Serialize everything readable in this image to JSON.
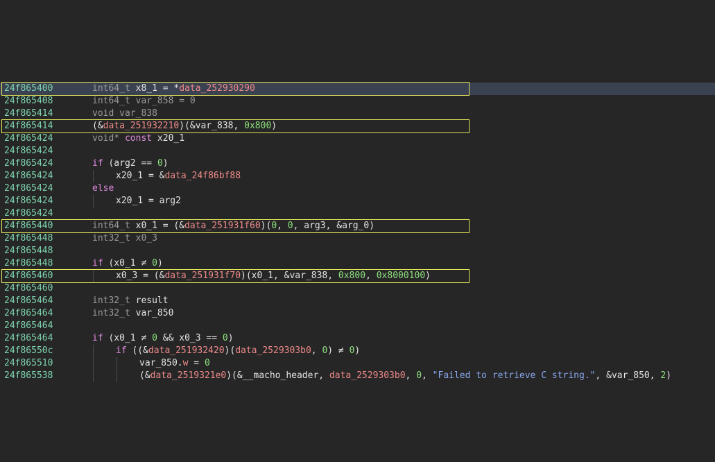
{
  "highlight_color": "#e4e65a",
  "address_color": "#7fd6b0",
  "lines": [
    {
      "addr": "24f865400",
      "current": true,
      "boxed": true,
      "indent": 0,
      "tokens": [
        {
          "t": "int64_t ",
          "c": "type"
        },
        {
          "t": "x8_1 = *",
          "c": "plain"
        },
        {
          "t": "data_252930290",
          "c": "data"
        }
      ]
    },
    {
      "addr": "24f865408",
      "indent": 0,
      "tokens": [
        {
          "t": "int64_t var_858 = 0",
          "c": "type"
        }
      ]
    },
    {
      "addr": "24f865414",
      "indent": 0,
      "tokens": [
        {
          "t": "void var_838",
          "c": "type"
        }
      ]
    },
    {
      "addr": "24f865414",
      "boxed": true,
      "indent": 0,
      "tokens": [
        {
          "t": "(&",
          "c": "plain"
        },
        {
          "t": "data_251932210",
          "c": "data"
        },
        {
          "t": ")(&var_838, ",
          "c": "plain"
        },
        {
          "t": "0x800",
          "c": "num"
        },
        {
          "t": ")",
          "c": "plain"
        }
      ]
    },
    {
      "addr": "24f865424",
      "indent": 0,
      "tokens": [
        {
          "t": "void* ",
          "c": "type"
        },
        {
          "t": "const",
          "c": "kw"
        },
        {
          "t": " x20_1",
          "c": "plain"
        }
      ]
    },
    {
      "addr": "24f865424",
      "indent": 0,
      "tokens": []
    },
    {
      "addr": "24f865424",
      "indent": 0,
      "tokens": [
        {
          "t": "if",
          "c": "kw"
        },
        {
          "t": " (arg2 ",
          "c": "plain"
        },
        {
          "t": "==",
          "c": "plain"
        },
        {
          "t": " ",
          "c": "plain"
        },
        {
          "t": "0",
          "c": "num"
        },
        {
          "t": ")",
          "c": "plain"
        }
      ]
    },
    {
      "addr": "24f865424",
      "indent": 1,
      "tokens": [
        {
          "t": "x20_1 = &",
          "c": "plain"
        },
        {
          "t": "data_24f86bf88",
          "c": "data"
        }
      ]
    },
    {
      "addr": "24f865424",
      "indent": 0,
      "tokens": [
        {
          "t": "else",
          "c": "kw"
        }
      ]
    },
    {
      "addr": "24f865424",
      "indent": 1,
      "tokens": [
        {
          "t": "x20_1 = arg2",
          "c": "plain"
        }
      ]
    },
    {
      "addr": "24f865424",
      "indent": 0,
      "tokens": []
    },
    {
      "addr": "24f865440",
      "boxed": true,
      "indent": 0,
      "tokens": [
        {
          "t": "int64_t ",
          "c": "type"
        },
        {
          "t": "x0_1 = (&",
          "c": "plain"
        },
        {
          "t": "data_251931f60",
          "c": "data"
        },
        {
          "t": ")(",
          "c": "plain"
        },
        {
          "t": "0",
          "c": "num"
        },
        {
          "t": ", ",
          "c": "plain"
        },
        {
          "t": "0",
          "c": "num"
        },
        {
          "t": ", arg3, &arg_0)",
          "c": "plain"
        }
      ]
    },
    {
      "addr": "24f865448",
      "indent": 0,
      "tokens": [
        {
          "t": "int32_t x0_3",
          "c": "type"
        }
      ]
    },
    {
      "addr": "24f865448",
      "indent": 0,
      "tokens": []
    },
    {
      "addr": "24f865448",
      "indent": 0,
      "tokens": [
        {
          "t": "if",
          "c": "kw"
        },
        {
          "t": " (x0_1 ",
          "c": "plain"
        },
        {
          "t": "≠",
          "c": "plain"
        },
        {
          "t": " ",
          "c": "plain"
        },
        {
          "t": "0",
          "c": "num"
        },
        {
          "t": ")",
          "c": "plain"
        }
      ]
    },
    {
      "addr": "24f865460",
      "boxed": true,
      "indent": 1,
      "tokens": [
        {
          "t": "x0_3 = (&",
          "c": "plain"
        },
        {
          "t": "data_251931f70",
          "c": "data"
        },
        {
          "t": ")(x0_1, &var_838, ",
          "c": "plain"
        },
        {
          "t": "0x800",
          "c": "num"
        },
        {
          "t": ", ",
          "c": "plain"
        },
        {
          "t": "0x8000100",
          "c": "num"
        },
        {
          "t": ")",
          "c": "plain"
        }
      ]
    },
    {
      "addr": "24f865460",
      "indent": 0,
      "tokens": []
    },
    {
      "addr": "24f865464",
      "indent": 0,
      "tokens": [
        {
          "t": "int32_t ",
          "c": "type"
        },
        {
          "t": "result",
          "c": "plain"
        }
      ]
    },
    {
      "addr": "24f865464",
      "indent": 0,
      "tokens": [
        {
          "t": "int32_t ",
          "c": "type"
        },
        {
          "t": "var_850",
          "c": "plain"
        }
      ]
    },
    {
      "addr": "24f865464",
      "indent": 0,
      "tokens": []
    },
    {
      "addr": "24f865464",
      "indent": 0,
      "tokens": [
        {
          "t": "if",
          "c": "kw"
        },
        {
          "t": " (x0_1 ",
          "c": "plain"
        },
        {
          "t": "≠",
          "c": "plain"
        },
        {
          "t": " ",
          "c": "plain"
        },
        {
          "t": "0",
          "c": "num"
        },
        {
          "t": " && x0_3 ",
          "c": "plain"
        },
        {
          "t": "==",
          "c": "plain"
        },
        {
          "t": " ",
          "c": "plain"
        },
        {
          "t": "0",
          "c": "num"
        },
        {
          "t": ")",
          "c": "plain"
        }
      ]
    },
    {
      "addr": "24f86550c",
      "indent": 1,
      "tokens": [
        {
          "t": "if",
          "c": "kw"
        },
        {
          "t": " ((&",
          "c": "plain"
        },
        {
          "t": "data_251932420",
          "c": "data"
        },
        {
          "t": ")(",
          "c": "plain"
        },
        {
          "t": "data_2529303b0",
          "c": "data"
        },
        {
          "t": ", ",
          "c": "plain"
        },
        {
          "t": "0",
          "c": "num"
        },
        {
          "t": ") ",
          "c": "plain"
        },
        {
          "t": "≠",
          "c": "plain"
        },
        {
          "t": " ",
          "c": "plain"
        },
        {
          "t": "0",
          "c": "num"
        },
        {
          "t": ")",
          "c": "plain"
        }
      ]
    },
    {
      "addr": "24f865510",
      "indent": 2,
      "tokens": [
        {
          "t": "var_850.",
          "c": "plain"
        },
        {
          "t": "w",
          "c": "field"
        },
        {
          "t": " = ",
          "c": "plain"
        },
        {
          "t": "0",
          "c": "num"
        }
      ]
    },
    {
      "addr": "24f865538",
      "indent": 2,
      "tokens": [
        {
          "t": "(&",
          "c": "plain"
        },
        {
          "t": "data_2519321e0",
          "c": "data"
        },
        {
          "t": ")(&__macho_header, ",
          "c": "plain"
        },
        {
          "t": "data_2529303b0",
          "c": "data"
        },
        {
          "t": ", ",
          "c": "plain"
        },
        {
          "t": "0",
          "c": "num"
        },
        {
          "t": ", ",
          "c": "plain"
        },
        {
          "t": "\"Failed to retrieve C string.\"",
          "c": "str"
        },
        {
          "t": ", &var_850, ",
          "c": "plain"
        },
        {
          "t": "2",
          "c": "num"
        },
        {
          "t": ")",
          "c": "plain"
        }
      ]
    }
  ]
}
